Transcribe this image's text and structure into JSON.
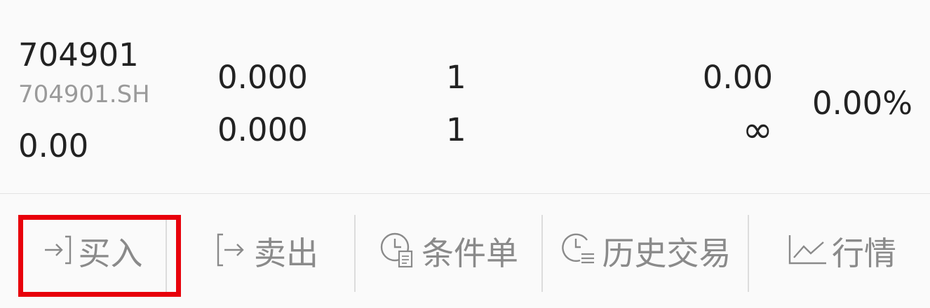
{
  "position": {
    "code": "704901",
    "symbol": "704901.SH",
    "price": "0.00",
    "cost_price_1": "0.000",
    "cost_price_2": "0.000",
    "qty_1": "1",
    "qty_2": "1",
    "value_1": "0.00",
    "value_2": "∞",
    "pnl_pct": "0.00%"
  },
  "actions": [
    {
      "label": "买入",
      "icon": "buy-arrow-icon"
    },
    {
      "label": "卖出",
      "icon": "sell-arrow-icon"
    },
    {
      "label": "条件单",
      "icon": "clock-doc-icon"
    },
    {
      "label": "历史交易",
      "icon": "clock-list-icon"
    },
    {
      "label": "行情",
      "icon": "line-chart-icon"
    }
  ],
  "highlight_color": "#e8000b"
}
